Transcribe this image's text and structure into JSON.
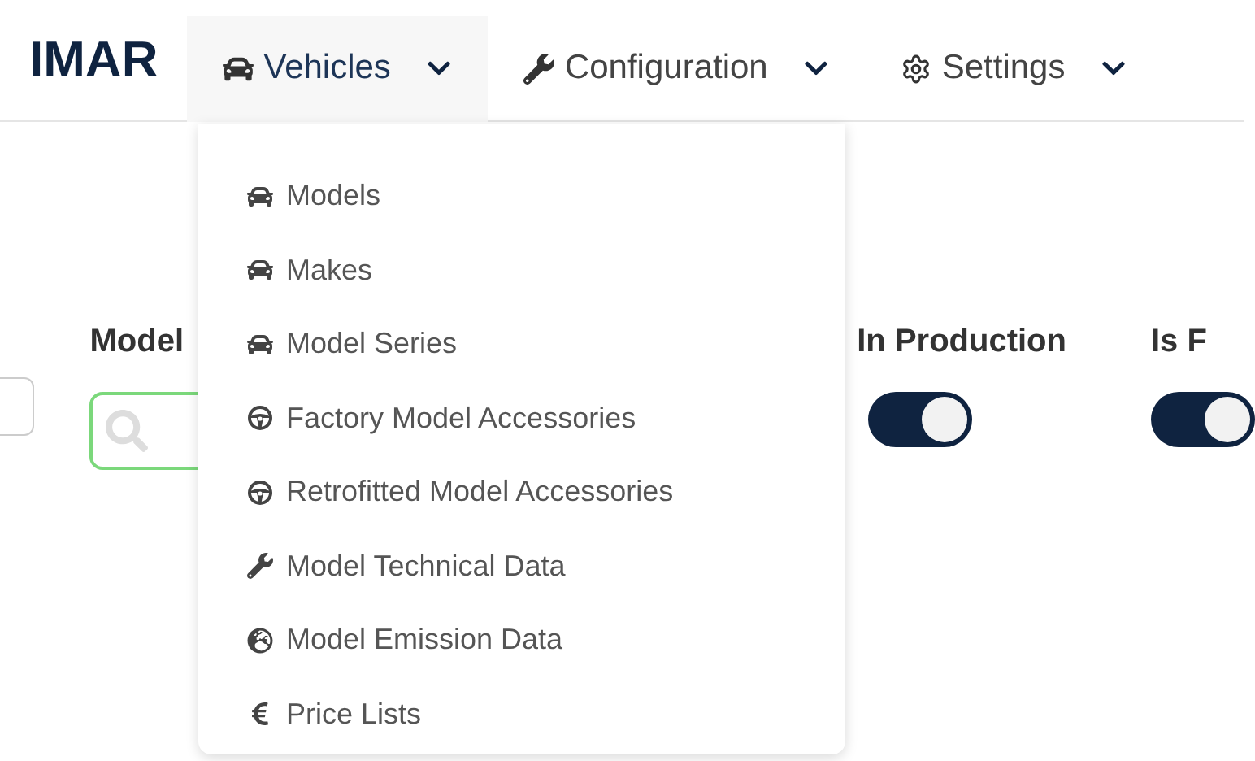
{
  "brand": "IMAR",
  "nav": [
    {
      "label": "Vehicles",
      "kind": "car",
      "selected": true
    },
    {
      "label": "Configuration",
      "kind": "wrench",
      "selected": false
    },
    {
      "label": "Settings",
      "kind": "gear",
      "selected": false
    }
  ],
  "menu": [
    {
      "label": "Models",
      "kind": "car"
    },
    {
      "label": "Makes",
      "kind": "car"
    },
    {
      "label": "Model Series",
      "kind": "car"
    },
    {
      "label": "Factory Model Accessories",
      "kind": "wheel"
    },
    {
      "label": "Retrofitted Model Accessories",
      "kind": "wheel"
    },
    {
      "label": "Model Technical Data",
      "kind": "wrench"
    },
    {
      "label": "Model Emission Data",
      "kind": "globe"
    },
    {
      "label": "Price Lists",
      "kind": "euro"
    }
  ],
  "filters": [
    {
      "label": "Model",
      "kind": "search"
    },
    {
      "label": "In Production",
      "kind": "toggle",
      "on": true
    },
    {
      "label": "Is F",
      "kind": "toggle",
      "on": true
    }
  ]
}
